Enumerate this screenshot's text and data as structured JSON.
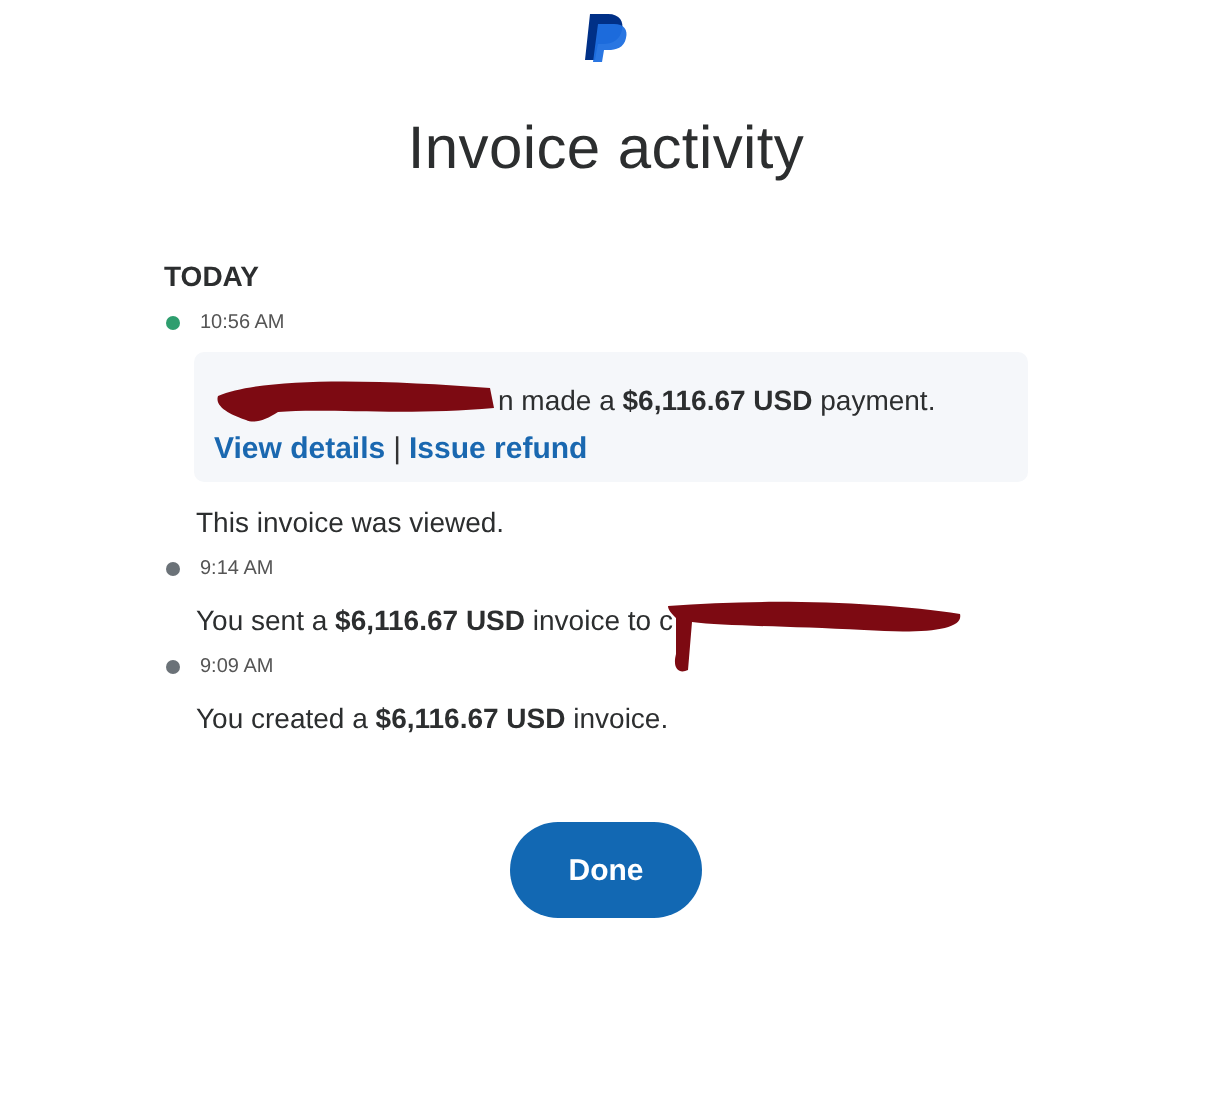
{
  "title": "Invoice activity",
  "section": "TODAY",
  "events": [
    {
      "time": "10:56 AM",
      "color": "#2e9e6e",
      "items": [
        {
          "kind": "card",
          "redacted_start": true,
          "text": "n made a **$6,116.67 USD** payment.",
          "links": [
            "View details",
            "Issue refund"
          ],
          "separator": "|"
        },
        {
          "kind": "note",
          "text": "This invoice was viewed."
        }
      ]
    },
    {
      "time": "9:14 AM",
      "color": "#6b7278",
      "items": [
        {
          "kind": "note",
          "redacted_end": true,
          "text": "You sent a **$6,116.67 USD** invoice to c"
        }
      ]
    },
    {
      "time": "9:09 AM",
      "color": "#6b7278",
      "items": [
        {
          "kind": "note",
          "text": "You created a **$6,116.67 USD** invoice."
        }
      ]
    }
  ],
  "button": "Done"
}
